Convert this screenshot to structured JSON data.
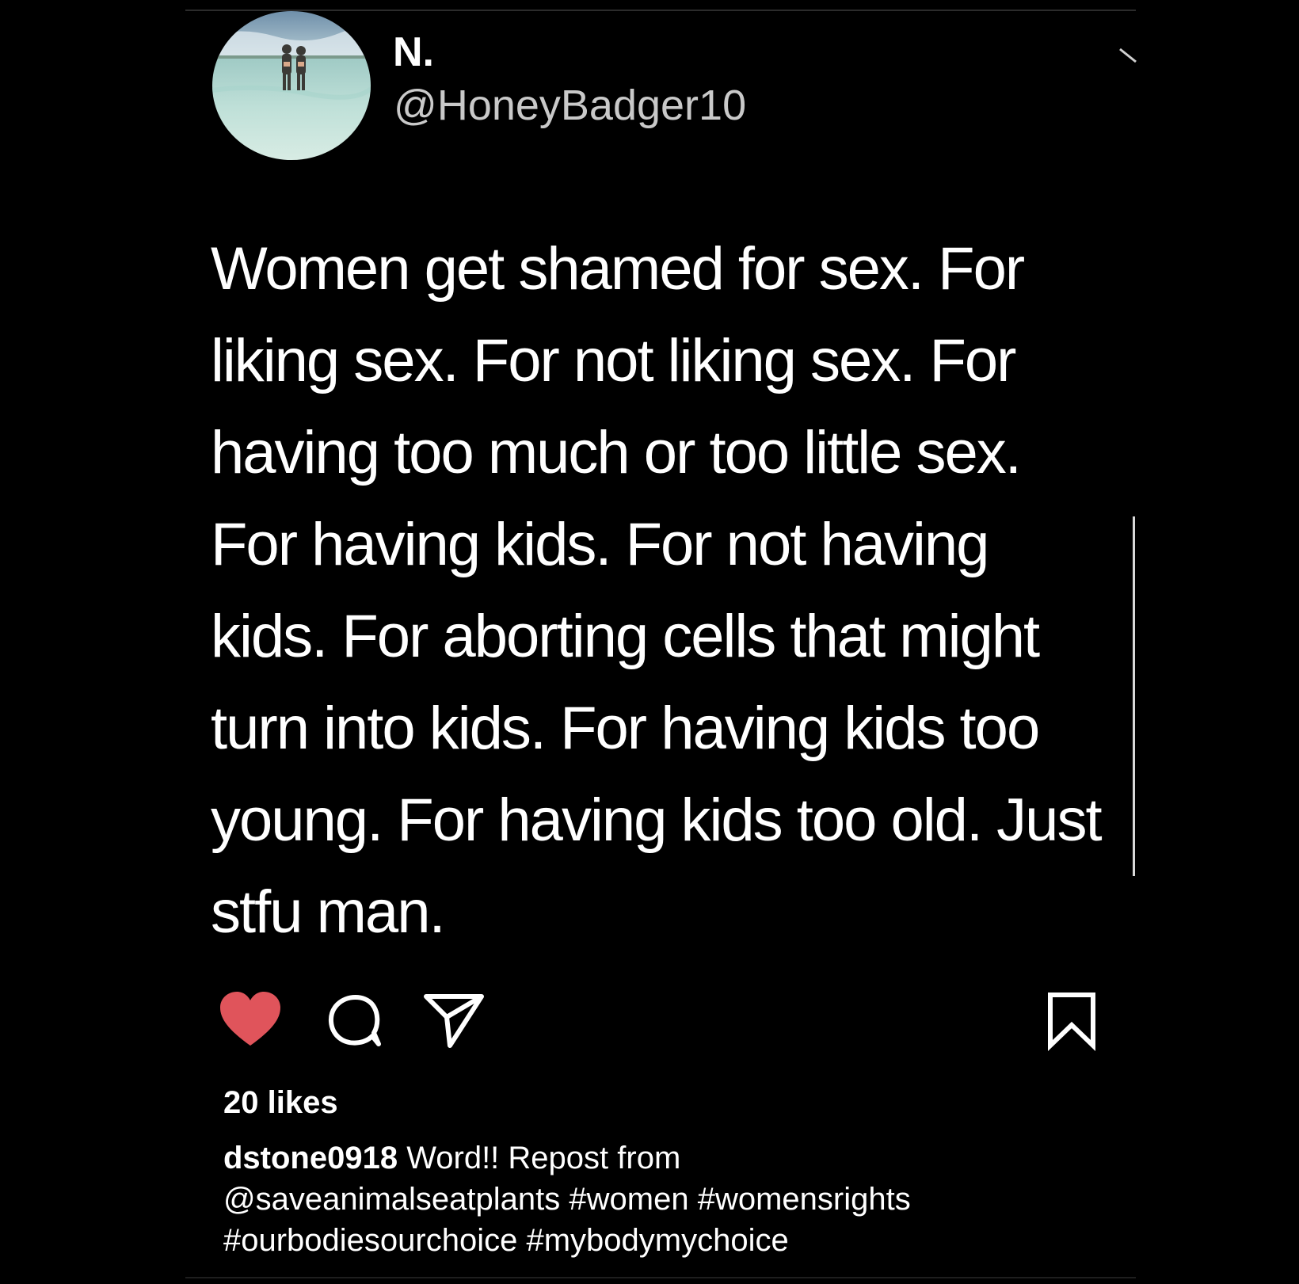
{
  "post": {
    "tweet": {
      "display_name": "N.",
      "handle": "@HoneyBadger10",
      "lines": [
        "Women get shamed for sex. For",
        "liking sex. For not liking sex. For",
        "having too much or too little sex.",
        "For having kids. For not having",
        "kids. For aborting cells that might",
        "turn into kids. For having kids too",
        "young. For having kids too old. Just",
        "stfu man."
      ]
    },
    "actions": {
      "like_icon": "heart-icon",
      "like_color": "#e0545b",
      "comment_icon": "comment-icon",
      "share_icon": "send-icon",
      "save_icon": "bookmark-icon"
    },
    "likes_label": "20 likes",
    "caption": {
      "username": "dstone0918",
      "line1_text": " Word!! Repost from",
      "line2": "@saveanimalseatplants #women #womensrights",
      "line3": "#ourbodiesourchoice #mybodymychoice"
    }
  }
}
